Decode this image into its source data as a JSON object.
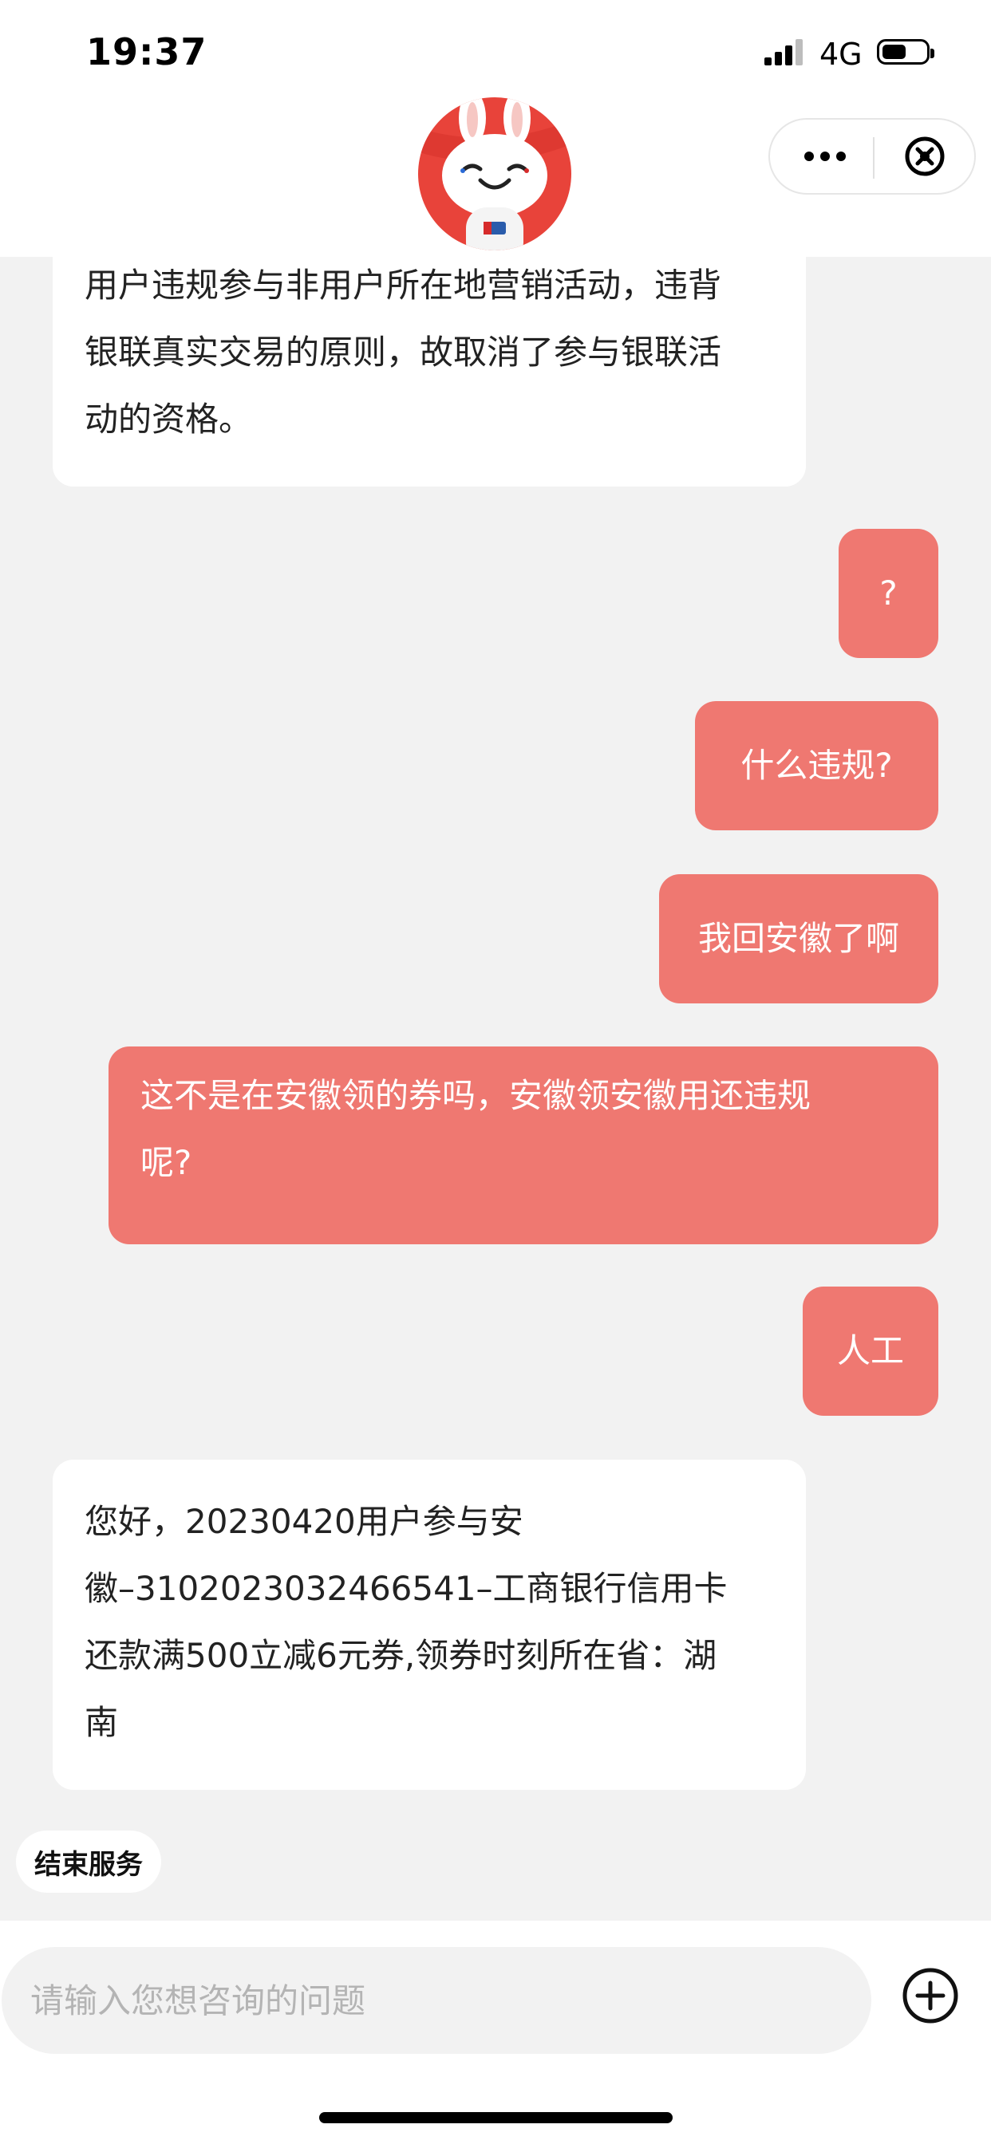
{
  "status_bar": {
    "time": "19:37",
    "network": "4G",
    "battery_level": 0.55,
    "signal_bars": 4
  },
  "header": {
    "more_icon": "ellipsis-icon",
    "close_icon": "circle-x-icon",
    "mascot_icon": "rabbit-mascot-icon"
  },
  "messages": [
    {
      "role": "bot",
      "lines": [
        "用户违规参与非用户所在地营销活动，违背",
        "银联真实交易的原则，故取消了参与银联活",
        "动的资格。"
      ]
    },
    {
      "role": "user",
      "text": "?"
    },
    {
      "role": "user",
      "text": "什么违规?"
    },
    {
      "role": "user",
      "text": "我回安徽了啊"
    },
    {
      "role": "user",
      "lines": [
        "这不是在安徽领的券吗，安徽领安徽用还违规",
        "呢?"
      ]
    },
    {
      "role": "user",
      "text": "人工"
    },
    {
      "role": "bot",
      "lines": [
        "您好，20230420用户参与安",
        "徽–3102023032466541–工商银行信用卡",
        "还款满500立减6元券,领券时刻所在省：湖",
        "南"
      ]
    }
  ],
  "quick_actions": {
    "end_service": "结束服务"
  },
  "input": {
    "placeholder": "请输入您想咨询的问题",
    "value": ""
  },
  "icons": {
    "add": "plus-circle-icon"
  },
  "colors": {
    "user_bubble": "#ef7871",
    "bot_bubble": "#ffffff",
    "background": "#f2f2f2"
  }
}
